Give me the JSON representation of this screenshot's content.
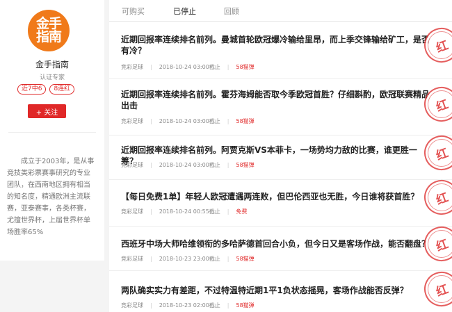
{
  "profile": {
    "avatar_text": "金手指南",
    "name": "金手指南",
    "role": "认证专家",
    "badges": [
      "近7中6",
      "8连红"
    ],
    "follow_label": "+ 关注",
    "bio": "成立于2003年，是从事竞技类彩票赛事研究的专业团队，在西南地区拥有相当的知名度，精通欧洲主流联赛，亚泰赛事，各类杯赛，尤擅世界杯，上届世界杯单场胜率65%"
  },
  "tabs": [
    {
      "label": "可购买",
      "active": false
    },
    {
      "label": "已停止",
      "active": true
    },
    {
      "label": "回顾",
      "active": false
    }
  ],
  "stamp_text": "红",
  "items": [
    {
      "title": "近期回报率连续排名前列。曼城首轮欧冠爆冷输给里昂，而上季交锋输给矿工，是否有冷？",
      "category": "竞彩足球",
      "deadline": "2018-10-24 03:00截止",
      "price": "58猫弹"
    },
    {
      "title": "近期回报率连续排名前列。霍芬海姆能否取今季欧冠首胜？仔细斟酌，欧冠联赛精品出击",
      "category": "竞彩足球",
      "deadline": "2018-10-24 03:00截止",
      "price": "58猫弹"
    },
    {
      "title": "近期回报率连续排名前列。阿贾克斯VS本菲卡，一场势均力敌的比赛，谁更胜一筹？",
      "category": "竞彩足球",
      "deadline": "2018-10-24 03:00截止",
      "price": "58猫弹"
    },
    {
      "title": "【每日免费1单】年轻人欧冠遭遇两连败，但巴伦西亚也无胜，今日谁将获首胜？",
      "category": "竞彩足球",
      "deadline": "2018-10-24 00:55截止",
      "price": "免费"
    },
    {
      "title": "西班牙中场大师哈维领衔的多哈萨德首回合小负，但今日又是客场作战，能否翻盘？",
      "category": "竞彩足球",
      "deadline": "2018-10-23 23:00截止",
      "price": "58猫弹"
    },
    {
      "title": "两队确实实力有差距，不过特温特近期1平1负状态摇晃，客场作战能否反弹？",
      "category": "竞彩足球",
      "deadline": "2018-10-23 02:00截止",
      "price": "58猫弹"
    }
  ]
}
